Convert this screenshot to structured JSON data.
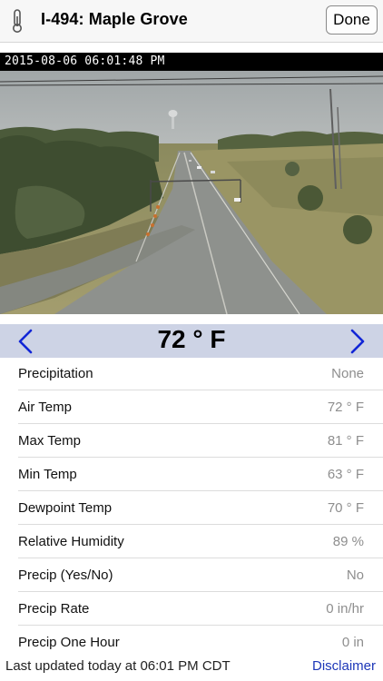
{
  "header": {
    "title": "I-494: Maple Grove",
    "done_label": "Done",
    "icon": "thermometer-icon"
  },
  "camera": {
    "timestamp": "2015-08-06 06:01:48 PM"
  },
  "temperature_bar": {
    "current": "72 ° F",
    "prev_icon": "chevron-left-icon",
    "next_icon": "chevron-right-icon",
    "accent_color": "#1226d6"
  },
  "readings": [
    {
      "label": "Precipitation",
      "value": "None"
    },
    {
      "label": "Air Temp",
      "value": "72 ° F"
    },
    {
      "label": "Max Temp",
      "value": "81 ° F"
    },
    {
      "label": "Min Temp",
      "value": "63 ° F"
    },
    {
      "label": "Dewpoint Temp",
      "value": "70 ° F"
    },
    {
      "label": "Relative Humidity",
      "value": "89 %"
    },
    {
      "label": "Precip (Yes/No)",
      "value": "No"
    },
    {
      "label": "Precip Rate",
      "value": "0  in/hr"
    },
    {
      "label": "Precip One Hour",
      "value": "0  in"
    }
  ],
  "footer": {
    "updated": "Last updated today at 06:01 PM CDT",
    "disclaimer": "Disclaimer"
  }
}
